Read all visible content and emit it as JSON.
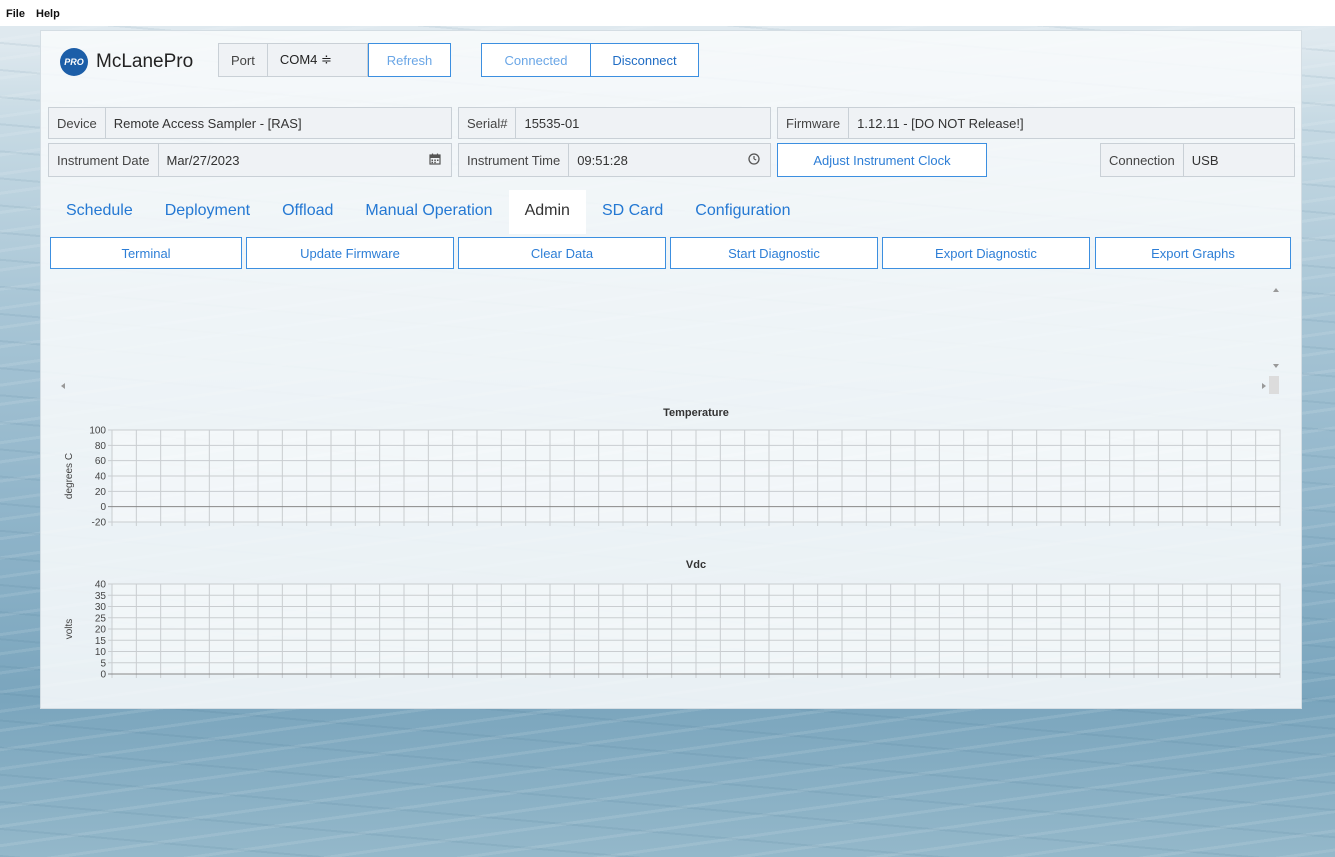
{
  "menu": {
    "file": "File",
    "help": "Help"
  },
  "header": {
    "logo_badge": "PRO",
    "brand": "McLanePro",
    "port_label": "Port",
    "port_value": "COM4 ≑",
    "refresh_label": "Refresh",
    "connected_label": "Connected",
    "disconnect_label": "Disconnect"
  },
  "info": {
    "device_label": "Device",
    "device_value": "Remote Access Sampler - [RAS]",
    "serial_label": "Serial#",
    "serial_value": "15535-01",
    "firmware_label": "Firmware",
    "firmware_value": "1.12.11 - [DO NOT Release!]",
    "date_label": "Instrument Date",
    "date_value": "Mar/27/2023",
    "time_label": "Instrument Time",
    "time_value": "09:51:28",
    "adjust_clock_label": "Adjust Instrument Clock",
    "connection_label": "Connection",
    "connection_value": "USB"
  },
  "tabs": [
    {
      "label": "Schedule"
    },
    {
      "label": "Deployment"
    },
    {
      "label": "Offload"
    },
    {
      "label": "Manual Operation"
    },
    {
      "label": "Admin"
    },
    {
      "label": "SD Card"
    },
    {
      "label": "Configuration"
    }
  ],
  "active_tab": "Admin",
  "actions": [
    {
      "label": "Terminal"
    },
    {
      "label": "Update Firmware"
    },
    {
      "label": "Clear Data"
    },
    {
      "label": "Start Diagnostic"
    },
    {
      "label": "Export Diagnostic"
    },
    {
      "label": "Export Graphs"
    }
  ],
  "icons": {
    "calendar": "calendar-icon",
    "clock": "clock-icon"
  },
  "colors": {
    "accent": "#2d7ed6",
    "logo": "#1c5ea8"
  },
  "chart_data": [
    {
      "type": "line",
      "title": "Temperature",
      "ylabel": "degrees C",
      "xlabel": "",
      "ylim": [
        -20,
        100
      ],
      "yticks": [
        "100",
        "80",
        "60",
        "40",
        "20",
        "0",
        "-20"
      ],
      "grid": true,
      "series": []
    },
    {
      "type": "line",
      "title": "Vdc",
      "ylabel": "volts",
      "xlabel": "",
      "ylim": [
        0,
        40
      ],
      "yticks": [
        "40",
        "35",
        "30",
        "25",
        "20",
        "15",
        "10",
        "5",
        "0"
      ],
      "grid": true,
      "series": []
    }
  ]
}
